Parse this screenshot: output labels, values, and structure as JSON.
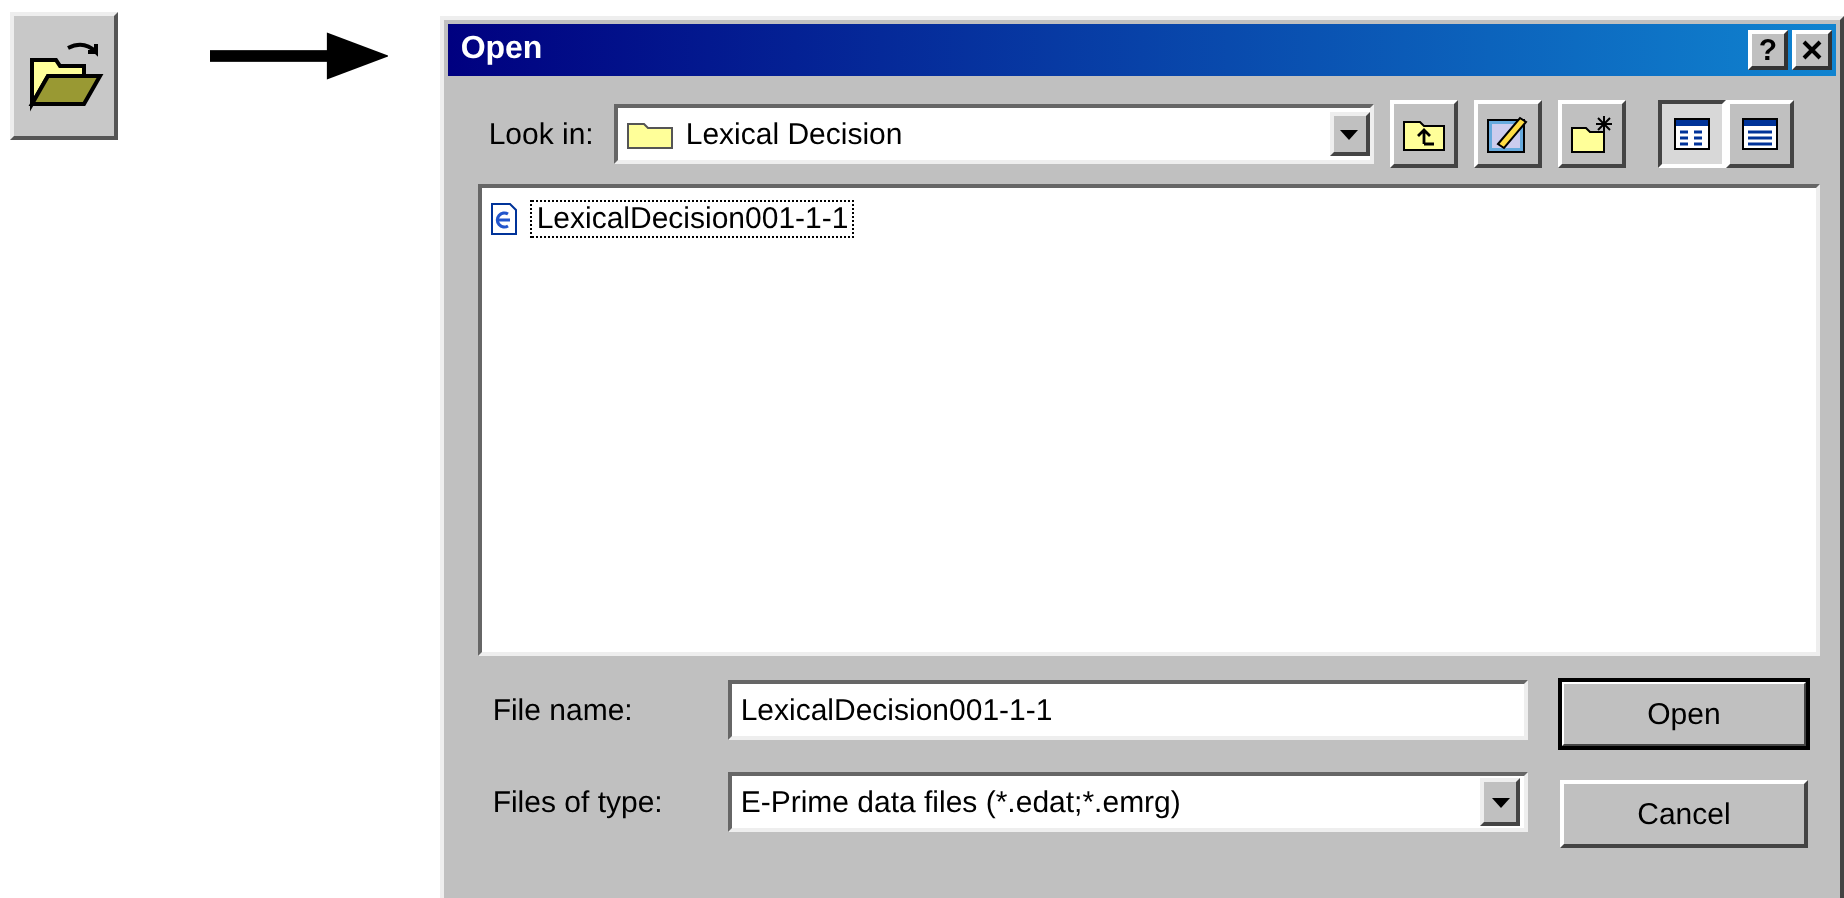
{
  "dialog": {
    "title": "Open",
    "help_button": "?"
  },
  "look_in": {
    "label": "Look in:",
    "value": "Lexical Decision"
  },
  "views": [
    {
      "selected": true
    },
    {
      "selected": false
    }
  ],
  "files": [
    {
      "name": "LexicalDecision001-1-1",
      "focused": true
    }
  ],
  "file_name": {
    "label": "File name:",
    "value": "LexicalDecision001-1-1"
  },
  "file_type": {
    "label": "Files of type:",
    "value": "E-Prime data files (*.edat;*.emrg)"
  },
  "buttons": [
    {
      "label": "Open",
      "default": true
    },
    {
      "label": "Cancel",
      "default": false
    }
  ]
}
